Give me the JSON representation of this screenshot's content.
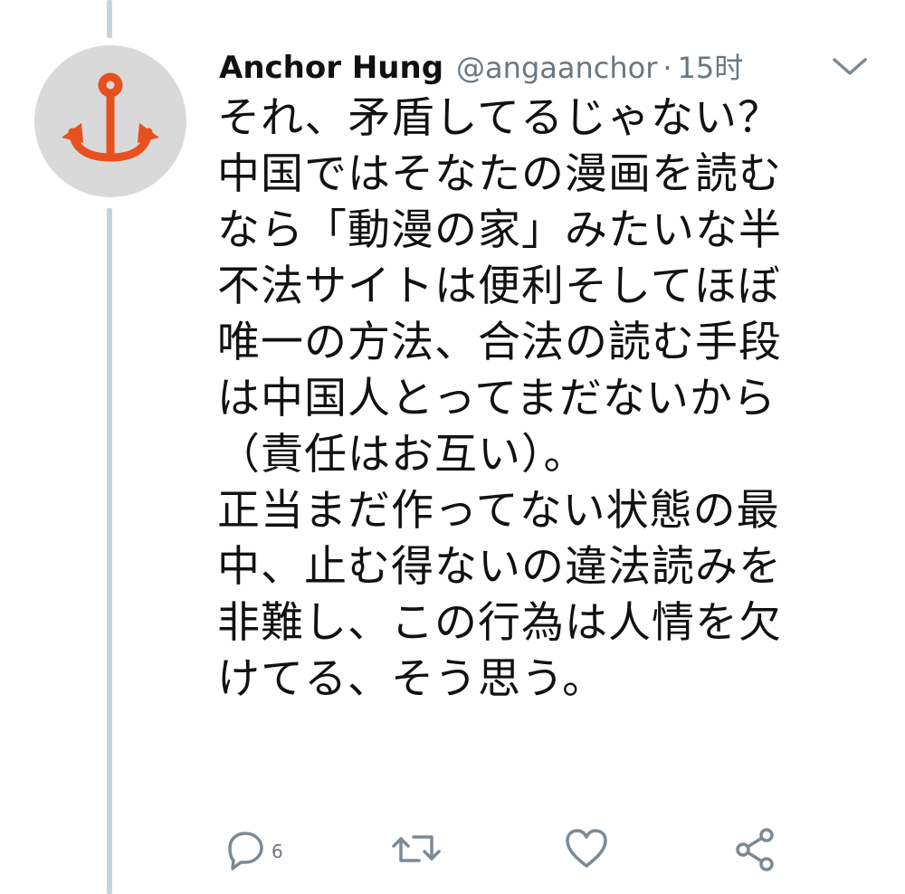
{
  "tweet": {
    "author": {
      "display_name": "Anchor Hung",
      "handle": "@angaanchor",
      "separator": "·",
      "time": "15时",
      "avatar_icon": "anchor-icon",
      "avatar_bg": "#d9d9d9",
      "avatar_color": "#e8501e"
    },
    "menu_icon": "chevron-down-icon",
    "lines": [
      "それ、矛盾してるじゃない？",
      "中国ではそなたの漫画を読む",
      "なら「動漫の家」みたいな半",
      "不法サイトは便利そしてほぼ",
      "唯一の方法、合法の読む手段",
      "は中国人とってまだないから",
      "（責任はお互い）。",
      "正当まだ作ってない状態の最",
      "中、止む得ないの違法読みを",
      "非難し、この行為は人情を欠",
      "けてる、そう思う。"
    ],
    "actions": {
      "reply": {
        "icon": "reply-bubble-icon",
        "count": "6"
      },
      "retweet": {
        "icon": "retweet-icon"
      },
      "like": {
        "icon": "heart-icon"
      },
      "share": {
        "icon": "share-icon"
      }
    }
  }
}
